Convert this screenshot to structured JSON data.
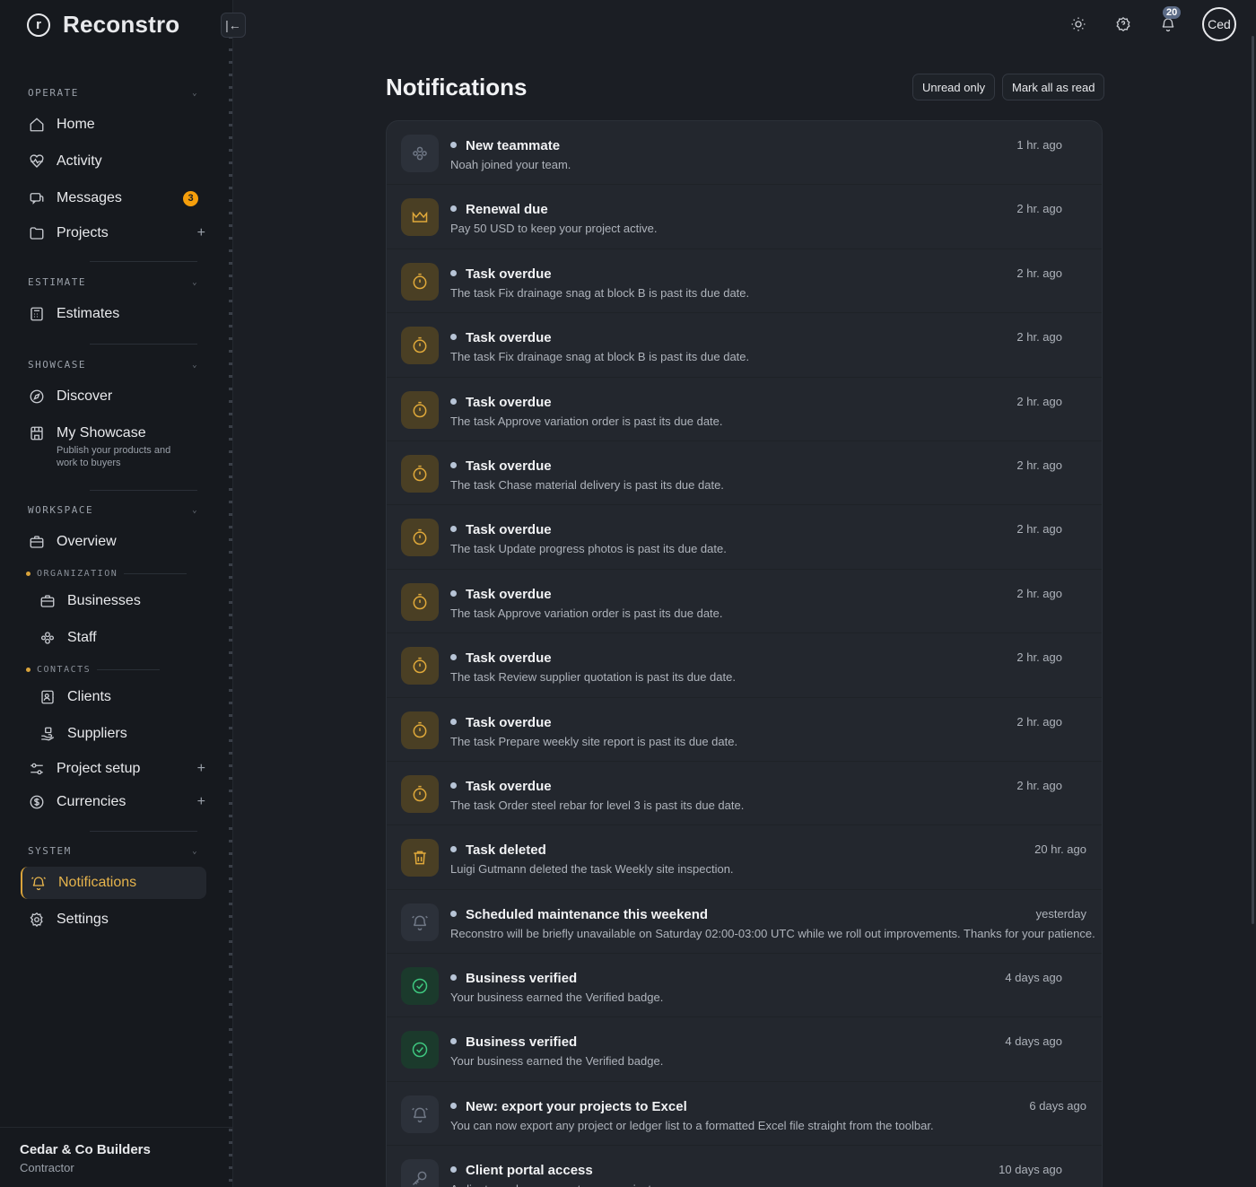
{
  "app": {
    "name": "Reconstro",
    "logo_letter": "r"
  },
  "sidebar": {
    "sections": {
      "operate": "OPERATE",
      "estimate": "ESTIMATE",
      "showcase": "SHOWCASE",
      "workspace": "WORKSPACE",
      "system": "SYSTEM"
    },
    "subsections": {
      "organization": "ORGANIZATION",
      "contacts": "CONTACTS"
    },
    "items": {
      "home": "Home",
      "activity": "Activity",
      "messages": "Messages",
      "messages_badge": "3",
      "projects": "Projects",
      "estimates": "Estimates",
      "discover": "Discover",
      "my_showcase": "My Showcase",
      "my_showcase_desc": "Publish your products and work to buyers",
      "overview": "Overview",
      "businesses": "Businesses",
      "staff": "Staff",
      "clients": "Clients",
      "suppliers": "Suppliers",
      "project_setup": "Project setup",
      "currencies": "Currencies",
      "notifications": "Notifications",
      "settings": "Settings"
    },
    "footer": {
      "org": "Cedar & Co Builders",
      "role": "Contractor"
    }
  },
  "topbar": {
    "bell_count": "20",
    "avatar_text": "Ced"
  },
  "page": {
    "title": "Notifications",
    "unread_only": "Unread only",
    "mark_all": "Mark all as read"
  },
  "notifications": [
    {
      "icon": "team-icon",
      "tone": "gray",
      "title": "New teammate",
      "body": "Noah joined your team.",
      "time": "1 hr. ago"
    },
    {
      "icon": "crown-icon",
      "tone": "amber",
      "title": "Renewal due",
      "body": "Pay 50 USD to keep your project active.",
      "time": "2 hr. ago"
    },
    {
      "icon": "timer-icon",
      "tone": "amber",
      "title": "Task overdue",
      "body": "The task Fix drainage snag at block B is past its due date.",
      "time": "2 hr. ago"
    },
    {
      "icon": "timer-icon",
      "tone": "amber",
      "title": "Task overdue",
      "body": "The task Fix drainage snag at block B is past its due date.",
      "time": "2 hr. ago"
    },
    {
      "icon": "timer-icon",
      "tone": "amber",
      "title": "Task overdue",
      "body": "The task Approve variation order is past its due date.",
      "time": "2 hr. ago"
    },
    {
      "icon": "timer-icon",
      "tone": "amber",
      "title": "Task overdue",
      "body": "The task Chase material delivery is past its due date.",
      "time": "2 hr. ago"
    },
    {
      "icon": "timer-icon",
      "tone": "amber",
      "title": "Task overdue",
      "body": "The task Update progress photos is past its due date.",
      "time": "2 hr. ago"
    },
    {
      "icon": "timer-icon",
      "tone": "amber",
      "title": "Task overdue",
      "body": "The task Approve variation order is past its due date.",
      "time": "2 hr. ago"
    },
    {
      "icon": "timer-icon",
      "tone": "amber",
      "title": "Task overdue",
      "body": "The task Review supplier quotation is past its due date.",
      "time": "2 hr. ago"
    },
    {
      "icon": "timer-icon",
      "tone": "amber",
      "title": "Task overdue",
      "body": "The task Prepare weekly site report is past its due date.",
      "time": "2 hr. ago"
    },
    {
      "icon": "timer-icon",
      "tone": "amber",
      "title": "Task overdue",
      "body": "The task Order steel rebar for level 3 is past its due date.",
      "time": "2 hr. ago"
    },
    {
      "icon": "trash-icon",
      "tone": "amber",
      "title": "Task deleted",
      "body": "Luigi Gutmann deleted the task Weekly site inspection.",
      "time": "20 hr. ago"
    },
    {
      "icon": "bell-icon",
      "tone": "gray",
      "title": "Scheduled maintenance this weekend",
      "body": "Reconstro will be briefly unavailable on Saturday 02:00-03:00 UTC while we roll out improvements. Thanks for your patience.",
      "time": "yesterday"
    },
    {
      "icon": "check-circle-icon",
      "tone": "green",
      "title": "Business verified",
      "body": "Your business earned the Verified badge.",
      "time": "4 days ago"
    },
    {
      "icon": "check-circle-icon",
      "tone": "green",
      "title": "Business verified",
      "body": "Your business earned the Verified badge.",
      "time": "4 days ago"
    },
    {
      "icon": "bell-icon",
      "tone": "gray",
      "title": "New: export your projects to Excel",
      "body": "You can now export any project or ledger list to a formatted Excel file straight from the toolbar.",
      "time": "6 days ago"
    },
    {
      "icon": "key-icon",
      "tone": "gray",
      "title": "Client portal access",
      "body": "A client now has access to your projects.",
      "time": "10 days ago"
    }
  ],
  "colors": {
    "accent": "#e5b34c",
    "badge": "#f59e0b",
    "verified": "#3ec77f",
    "background": "#1b1e24",
    "sidebar": "#16191e",
    "card": "#23272e"
  }
}
